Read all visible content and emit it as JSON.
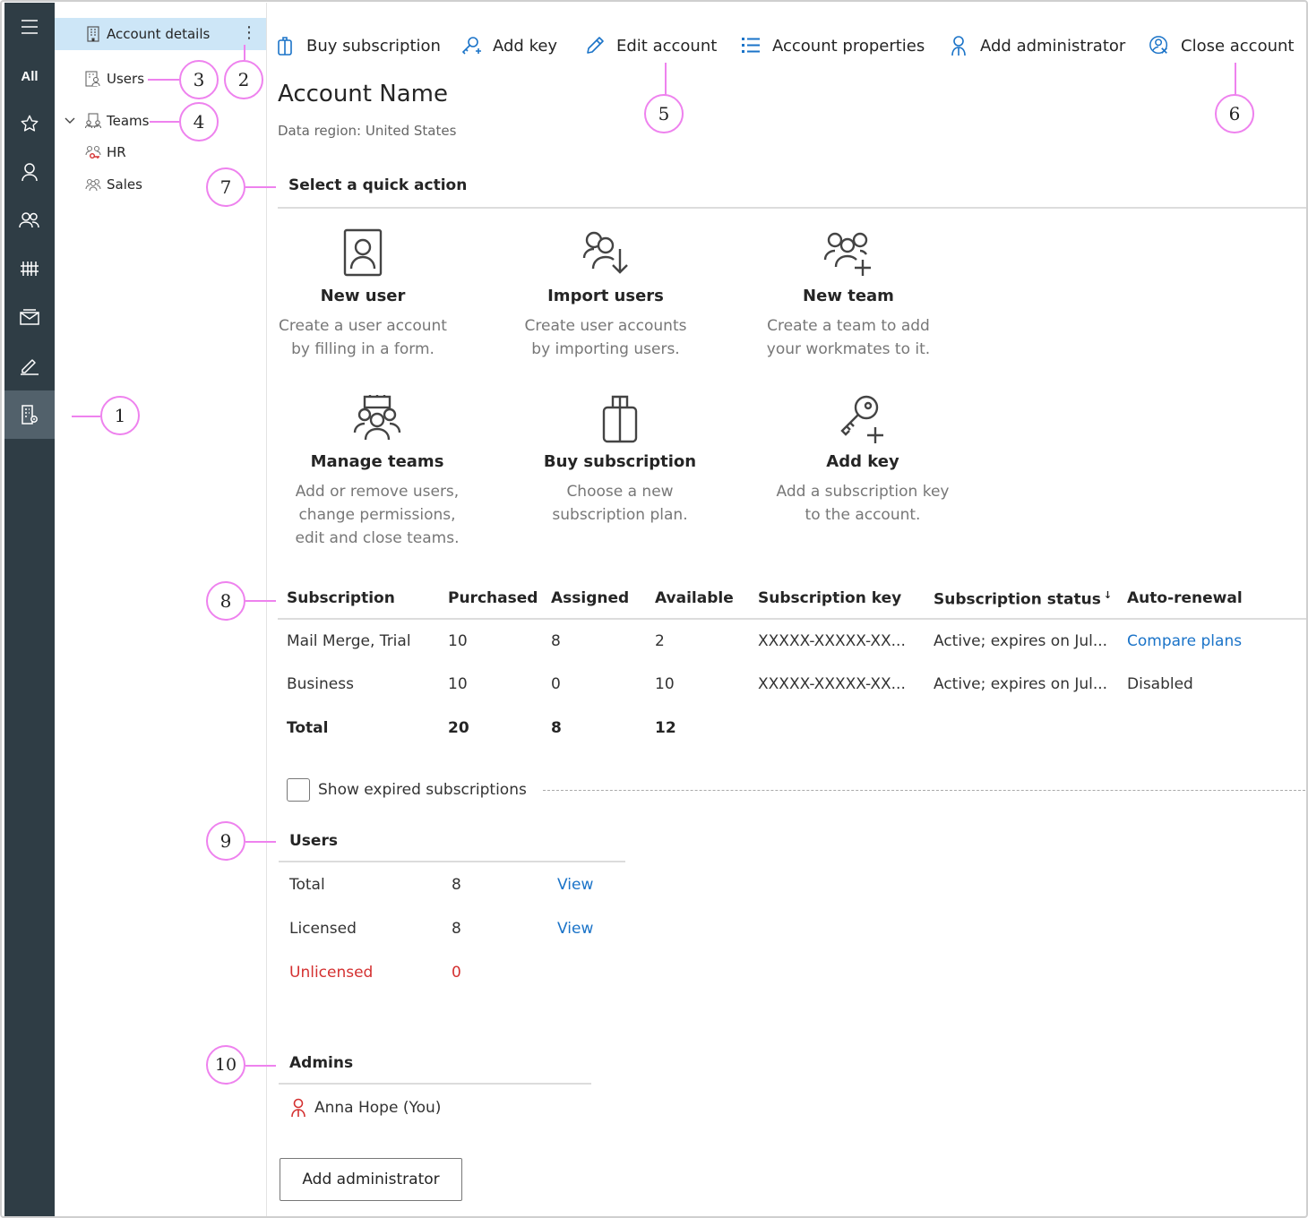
{
  "rail": {
    "all_label": "All",
    "items": [
      "menu-icon",
      "all",
      "star-icon",
      "user-icon",
      "users-icon",
      "hashtag-icon",
      "mail-icon",
      "signature-icon",
      "account-settings-icon"
    ]
  },
  "tree": {
    "account_details": "Account details",
    "users": "Users",
    "teams": "Teams",
    "teams_children": [
      "HR",
      "Sales"
    ]
  },
  "toolbar": {
    "buy_subscription": "Buy subscription",
    "add_key": "Add key",
    "edit_account": "Edit account",
    "account_properties": "Account properties",
    "add_administrator": "Add administrator",
    "close_account": "Close account"
  },
  "account": {
    "name": "Account Name",
    "region": "Data region: United States"
  },
  "quick_actions": {
    "title": "Select a quick action",
    "items": [
      {
        "title": "New user",
        "desc1": "Create a user account",
        "desc2": "by filling in a form.",
        "desc3": ""
      },
      {
        "title": "Import users",
        "desc1": "Create user accounts",
        "desc2": "by importing users.",
        "desc3": ""
      },
      {
        "title": "New team",
        "desc1": "Create a team to add",
        "desc2": "your workmates to it.",
        "desc3": ""
      },
      {
        "title": "Manage teams",
        "desc1": "Add or remove users,",
        "desc2": "change permissions,",
        "desc3": "edit and close teams."
      },
      {
        "title": "Buy subscription",
        "desc1": "Choose a new",
        "desc2": "subscription plan.",
        "desc3": ""
      },
      {
        "title": "Add key",
        "desc1": "Add a subscription key",
        "desc2": "to the account.",
        "desc3": ""
      }
    ]
  },
  "subscriptions": {
    "headers": [
      "Subscription",
      "Purchased",
      "Assigned",
      "Available",
      "Subscription key",
      "Subscription status",
      "Auto-renewal"
    ],
    "sort_indicator": "↓",
    "rows": [
      {
        "name": "Mail Merge, Trial",
        "purchased": "10",
        "assigned": "8",
        "available": "2",
        "key": "XXXXX-XXXXX-XX...",
        "status": "Active; expires on Jul...",
        "renewal": "Compare plans"
      },
      {
        "name": "Business",
        "purchased": "10",
        "assigned": "0",
        "available": "10",
        "key": "XXXXX-XXXXX-XX...",
        "status": "Active; expires on Jul...",
        "renewal": "Disabled"
      }
    ],
    "total": {
      "label": "Total",
      "purchased": "20",
      "assigned": "8",
      "available": "12"
    },
    "show_expired": "Show expired subscriptions"
  },
  "users_summary": {
    "title": "Users",
    "rows": [
      {
        "label": "Total",
        "value": "8",
        "action": "View"
      },
      {
        "label": "Licensed",
        "value": "8",
        "action": "View"
      },
      {
        "label": "Unlicensed",
        "value": "0",
        "action": ""
      }
    ]
  },
  "admins": {
    "title": "Admins",
    "list": [
      "Anna Hope (You)"
    ],
    "add_button": "Add administrator"
  },
  "callouts": [
    "1",
    "2",
    "3",
    "4",
    "5",
    "6",
    "7",
    "8",
    "9",
    "10"
  ],
  "colors": {
    "rail_bg": "#2f3d45",
    "selected_bg": "#cde6f7",
    "accent": "#1a73c8",
    "warning": "#d43131",
    "callout": "#ee82ee"
  }
}
